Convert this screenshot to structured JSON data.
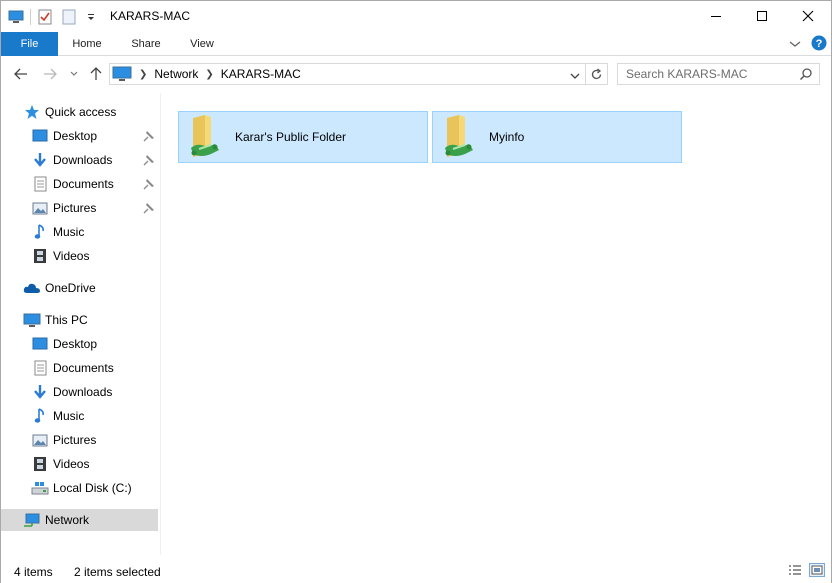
{
  "window": {
    "title": "KARARS-MAC"
  },
  "ribbon": {
    "tabs": [
      "File",
      "Home",
      "Share",
      "View"
    ]
  },
  "address": {
    "crumbs": [
      "Network",
      "KARARS-MAC"
    ]
  },
  "search": {
    "placeholder": "Search KARARS-MAC"
  },
  "navpane": {
    "quick_access": "Quick access",
    "quick_items": [
      "Desktop",
      "Downloads",
      "Documents",
      "Pictures",
      "Music",
      "Videos"
    ],
    "onedrive": "OneDrive",
    "this_pc": "This PC",
    "pc_items": [
      "Desktop",
      "Documents",
      "Downloads",
      "Music",
      "Pictures",
      "Videos",
      "Local Disk (C:)"
    ],
    "network": "Network"
  },
  "content": {
    "folders": [
      {
        "name": "Karar's Public Folder",
        "selected": true
      },
      {
        "name": "Myinfo",
        "selected": true
      }
    ]
  },
  "status": {
    "item_count": "4 items",
    "selection": "2 items selected"
  },
  "colors": {
    "file_tab": "#1979ca",
    "selected_tile": "#cce8ff",
    "selected_nav": "#d9d9d9",
    "help": "#1979ca"
  }
}
